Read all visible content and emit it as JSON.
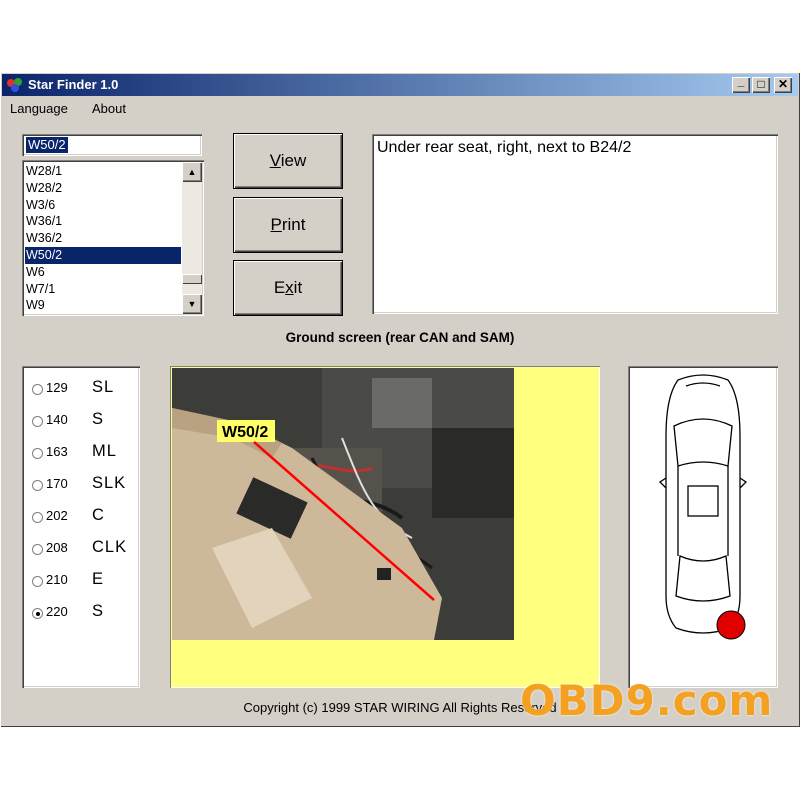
{
  "window": {
    "title": "Star Finder 1.0",
    "controls": {
      "minimize": "_",
      "maximize": "□",
      "close": "✕"
    }
  },
  "menu": {
    "language": "Language",
    "about": "About"
  },
  "component_search": {
    "value": "W50/2"
  },
  "component_list": {
    "items": [
      "W28/1",
      "W28/2",
      "W3/6",
      "W36/1",
      "W36/2",
      "W50/2",
      "W6",
      "W7/1",
      "W9"
    ],
    "selected": "W50/2"
  },
  "buttons": {
    "view": {
      "ul": "V",
      "rest": "iew"
    },
    "print": {
      "ul": "P",
      "rest": "rint"
    },
    "exit": {
      "pre": "E",
      "ul": "x",
      "rest": "it"
    }
  },
  "location_text": "Under rear seat, right, next to B24/2",
  "caption": "Ground screen (rear CAN and SAM)",
  "models": [
    {
      "num": "129",
      "code": "SL",
      "checked": false
    },
    {
      "num": "140",
      "code": "S",
      "checked": false
    },
    {
      "num": "163",
      "code": "ML",
      "checked": false
    },
    {
      "num": "170",
      "code": "SLK",
      "checked": false
    },
    {
      "num": "202",
      "code": "C",
      "checked": false
    },
    {
      "num": "208",
      "code": "CLK",
      "checked": false
    },
    {
      "num": "210",
      "code": "E",
      "checked": false
    },
    {
      "num": "220",
      "code": "S",
      "checked": true
    }
  ],
  "photo": {
    "label": "W50/2"
  },
  "copyright": "Copyright (c) 1999 STAR WIRING  All Rights Reserved",
  "watermark": "OBD9.com",
  "colors": {
    "selection": "#0a246a",
    "photo_background": "#ffff80",
    "marker": "#e00000",
    "watermark": "#f4a020"
  }
}
